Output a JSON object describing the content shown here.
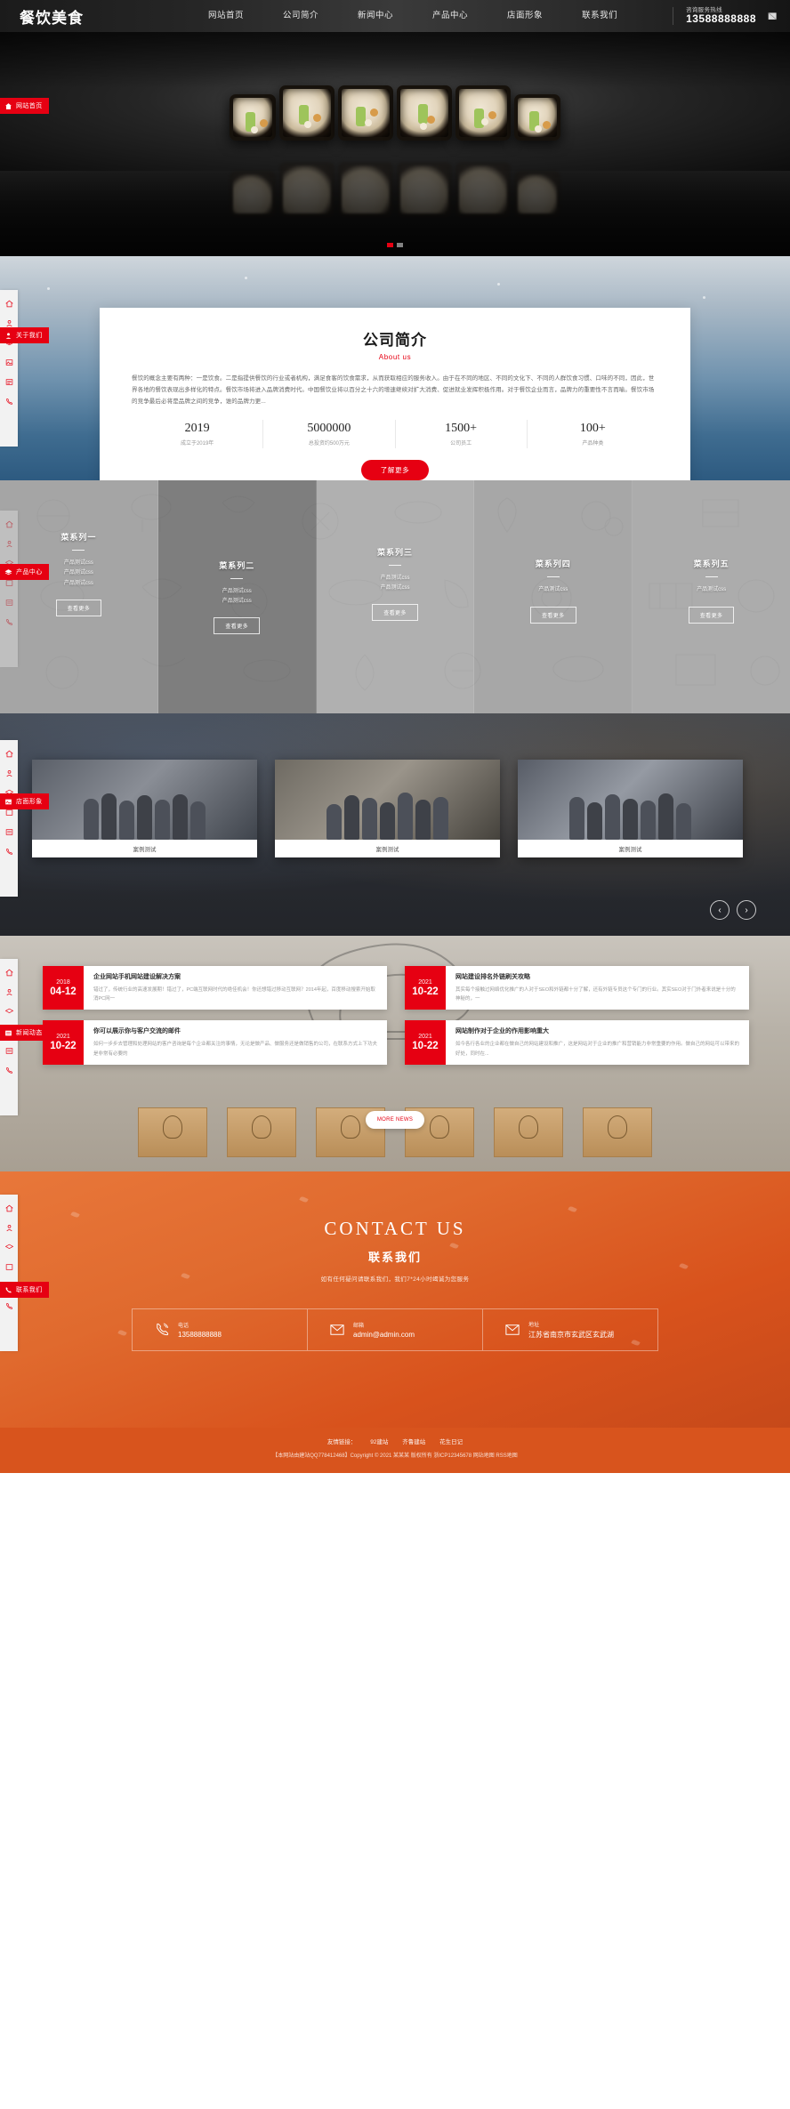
{
  "header": {
    "logo": "餐饮美食",
    "nav": [
      {
        "label": "网站首页"
      },
      {
        "label": "公司简介"
      },
      {
        "label": "新闻中心"
      },
      {
        "label": "产品中心"
      },
      {
        "label": "店面形象"
      },
      {
        "label": "联系我们"
      }
    ],
    "hotline_label": "咨询服务热线",
    "hotline_number": "13588888888"
  },
  "banner": {
    "side_tag": "网站首页"
  },
  "sidenav": {
    "tags": [
      {
        "label": "网站首页",
        "icon": "home-icon"
      },
      {
        "label": "关于我们",
        "icon": "user-icon"
      },
      {
        "label": "产品中心",
        "icon": "layers-icon"
      },
      {
        "label": "店面形象",
        "icon": "image-icon"
      },
      {
        "label": "新闻动态",
        "icon": "news-icon"
      },
      {
        "label": "联系我们",
        "icon": "phone-icon"
      }
    ]
  },
  "about": {
    "title": "公司简介",
    "subtitle": "About us",
    "text": "餐饮的概念主要有两种：一是饮食。二是指提供餐饮的行业或者机构，满足食客的饮食需求，从而获取相应的服务收入。由于在不同的地区、不同的文化下、不同的人群饮食习惯、口味的不同，因此，世界各地的餐饮表现出多样化的特点。餐饮市场将进入品牌消费时代。中国餐饮业将以百分之十六的增速继续对扩大消费、促进就业发挥积极作用。对于餐饮企业而言，品牌力的重要性不言而喻。餐饮市场的竞争最后必将是品牌之间的竞争，谁的品牌力更...",
    "stats": [
      {
        "value": "2019",
        "label": "成立于2019年"
      },
      {
        "value": "5000000",
        "label": "总投资约500万元"
      },
      {
        "value": "1500+",
        "label": "公司员工"
      },
      {
        "value": "100+",
        "label": "产品种类"
      }
    ],
    "button": "了解更多"
  },
  "products": {
    "items": [
      {
        "name": "菜系列一",
        "subs": [
          "产品测试css",
          "产品测试css",
          "产品测试css"
        ],
        "button": "查看更多"
      },
      {
        "name": "菜系列二",
        "subs": [
          "产品测试css",
          "产品测试css"
        ],
        "button": "查看更多"
      },
      {
        "name": "菜系列三",
        "subs": [
          "产品测试css",
          "产品测试css"
        ],
        "button": "查看更多"
      },
      {
        "name": "菜系列四",
        "subs": [
          "产品测试css"
        ],
        "button": "查看更多"
      },
      {
        "name": "菜系列五",
        "subs": [
          "产品测试css"
        ],
        "button": "查看更多"
      }
    ]
  },
  "gallery": {
    "cards": [
      {
        "caption": "案例测试"
      },
      {
        "caption": "案例测试"
      },
      {
        "caption": "案例测试"
      }
    ],
    "prev": "‹",
    "next": "›"
  },
  "news": {
    "items": [
      {
        "year": "2018",
        "day": "04-12",
        "title": "企业网站手机网站建设解决方案",
        "desc": "错过了，传统行业的高速发展期！错过了，PC端互联网时代的绝佳机会！你还想错过移动互联网？2014年起，百度移动搜索开始取消PC网一"
      },
      {
        "year": "2021",
        "day": "10-22",
        "title": "网站建设排名外链刷关攻略",
        "desc": "其实每个接触过网络优化推广的人对于SEO和外链都十分了解，还有外链专员这个专门的行业。其实SEO对于门外者来说是十分的神秘的，一"
      },
      {
        "year": "2021",
        "day": "10-22",
        "title": "你可以展示你与客户交流的邮件",
        "desc": "如何一步步去管理和处理网站的客户咨询是每个企业都关注的事情，无论是做产品、做服务还是做销售的公司，在联系方式上下功夫是非常有必要的"
      },
      {
        "year": "2021",
        "day": "10-22",
        "title": "网站制作对于企业的作用影响重大",
        "desc": "如今各行各业的企业都在做自己的网站建设和推广，这是网站对于企业的推广和营销能力非常重要的作用。做自己的网站可以带来的好处，同时在..."
      }
    ],
    "more": "MORE NEWS"
  },
  "contact": {
    "title_en": "CONTACT US",
    "title_cn": "联系我们",
    "desc": "如有任何疑问请联系我们，我们7*24小时竭诚为您服务",
    "cells": [
      {
        "icon": "phone-icon",
        "label": "电话",
        "value": "13588888888"
      },
      {
        "icon": "mail-icon",
        "label": "邮箱",
        "value": "admin@admin.com"
      },
      {
        "icon": "location-icon",
        "label": "地址",
        "value": "江苏省南京市玄武区玄武湖"
      }
    ]
  },
  "footer": {
    "links_prefix": "友情链接：",
    "links": [
      "92建站",
      "齐鲁建站",
      "花生日记"
    ],
    "copyright": "【本网站由建站QQ778412468】Copyright © 2021 某某某 版权所有 浙ICP12345678 网站地图 RSS地图"
  },
  "colors": {
    "accent": "#e60012",
    "contact_bg": "#e0682c",
    "header_bg": "#222222"
  }
}
